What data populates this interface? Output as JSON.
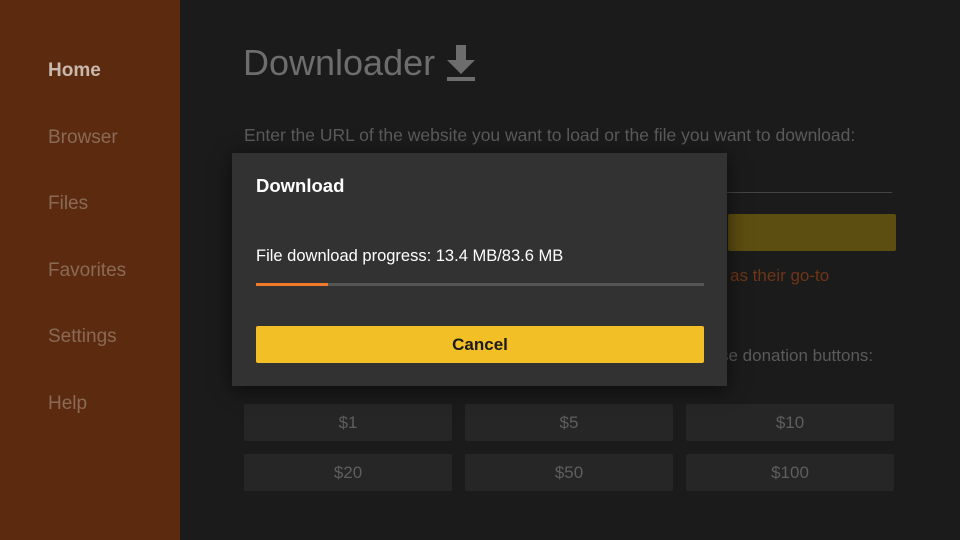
{
  "sidebar": {
    "items": [
      {
        "label": "Home",
        "active": true
      },
      {
        "label": "Browser",
        "active": false
      },
      {
        "label": "Files",
        "active": false
      },
      {
        "label": "Favorites",
        "active": false
      },
      {
        "label": "Settings",
        "active": false
      },
      {
        "label": "Help",
        "active": false
      }
    ]
  },
  "main": {
    "title": "Downloader",
    "title_icon": "download-arrow-icon",
    "prompt": "Enter the URL of the website you want to load or the file you want to download:",
    "promo_fragment": "as their go-to",
    "donation_note_fragment": "se donation buttons:",
    "donations": [
      {
        "label": "$1"
      },
      {
        "label": "$5"
      },
      {
        "label": "$10"
      },
      {
        "label": "$20"
      },
      {
        "label": "$50"
      },
      {
        "label": "$100"
      }
    ]
  },
  "dialog": {
    "title": "Download",
    "message": "File download progress: 13.4 MB/83.6 MB",
    "progress_fraction": 0.16,
    "cancel_label": "Cancel"
  },
  "colors": {
    "sidebar_bg": "#5c2b0f",
    "accent_yellow": "#f2c026",
    "progress_orange": "#f07b2d",
    "dialog_bg": "#323232"
  }
}
